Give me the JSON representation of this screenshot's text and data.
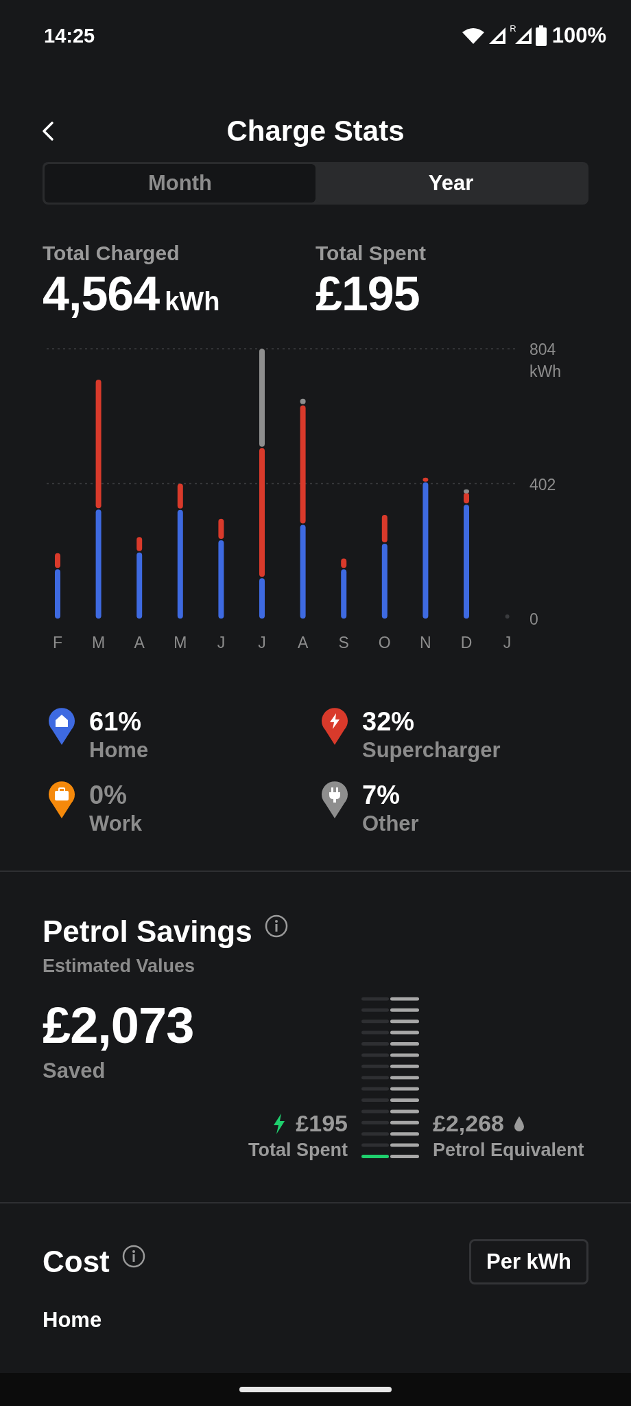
{
  "status_bar": {
    "time": "14:25",
    "roaming": "R",
    "battery": "100%"
  },
  "header": {
    "title": "Charge Stats"
  },
  "tabs": [
    {
      "label": "Month",
      "selected": false
    },
    {
      "label": "Year",
      "selected": true
    }
  ],
  "totals": [
    {
      "label": "Total Charged",
      "value": "4,564",
      "unit": "kWh"
    },
    {
      "label": "Total Spent",
      "value": "£195"
    }
  ],
  "chart": {
    "chart_data": {
      "type": "bar",
      "stacked": true,
      "ylabel": "kWh",
      "categories": [
        "F",
        "M",
        "A",
        "M",
        "J",
        "J",
        "A",
        "S",
        "O",
        "N",
        "D",
        "J"
      ],
      "series": [
        {
          "name": "Home",
          "color": "#3e6ae1",
          "values": [
            147,
            325,
            197,
            324,
            233,
            120,
            279,
            147,
            223,
            406,
            339,
            0
          ]
        },
        {
          "name": "Supercharger",
          "color": "#d93a2b",
          "values": [
            48,
            387,
            46,
            78,
            64,
            388,
            356,
            32,
            86,
            14,
            36,
            0
          ]
        },
        {
          "name": "Work",
          "color": "#f5890b",
          "values": [
            0,
            0,
            0,
            0,
            0,
            0,
            0,
            0,
            0,
            0,
            0,
            0
          ]
        },
        {
          "name": "Other",
          "color": "#8e8e8e",
          "values": [
            0,
            0,
            0,
            0,
            0,
            296,
            20,
            0,
            0,
            0,
            10,
            0
          ]
        }
      ],
      "ylim": [
        0,
        804
      ],
      "yticks": [
        {
          "value": 0,
          "label": "0"
        },
        {
          "value": 402,
          "label": "402"
        },
        {
          "value": 804,
          "label": "804"
        }
      ]
    }
  },
  "legend": [
    {
      "kind": "home",
      "percent": "61%",
      "dimmed": false
    },
    {
      "kind": "bolt",
      "percent": "32%",
      "dimmed": false
    },
    {
      "kind": "briefcase",
      "percent": "0%",
      "dimmed": true
    },
    {
      "kind": "plug",
      "percent": "7%",
      "dimmed": false
    }
  ],
  "petrol_savings": {
    "title": "Petrol Savings",
    "subtitle": "Estimated Values",
    "saved_value": "£2,073",
    "saved_label": "Saved",
    "spent_value": "£195",
    "spent_label": "Total Spent",
    "petrol_value": "£2,268",
    "petrol_label": "Petrol Equivalent",
    "gauge": {
      "level": 0.086
    }
  },
  "cost": {
    "title": "Cost",
    "unit_button": "Per kWh",
    "first_row": "Home"
  }
}
